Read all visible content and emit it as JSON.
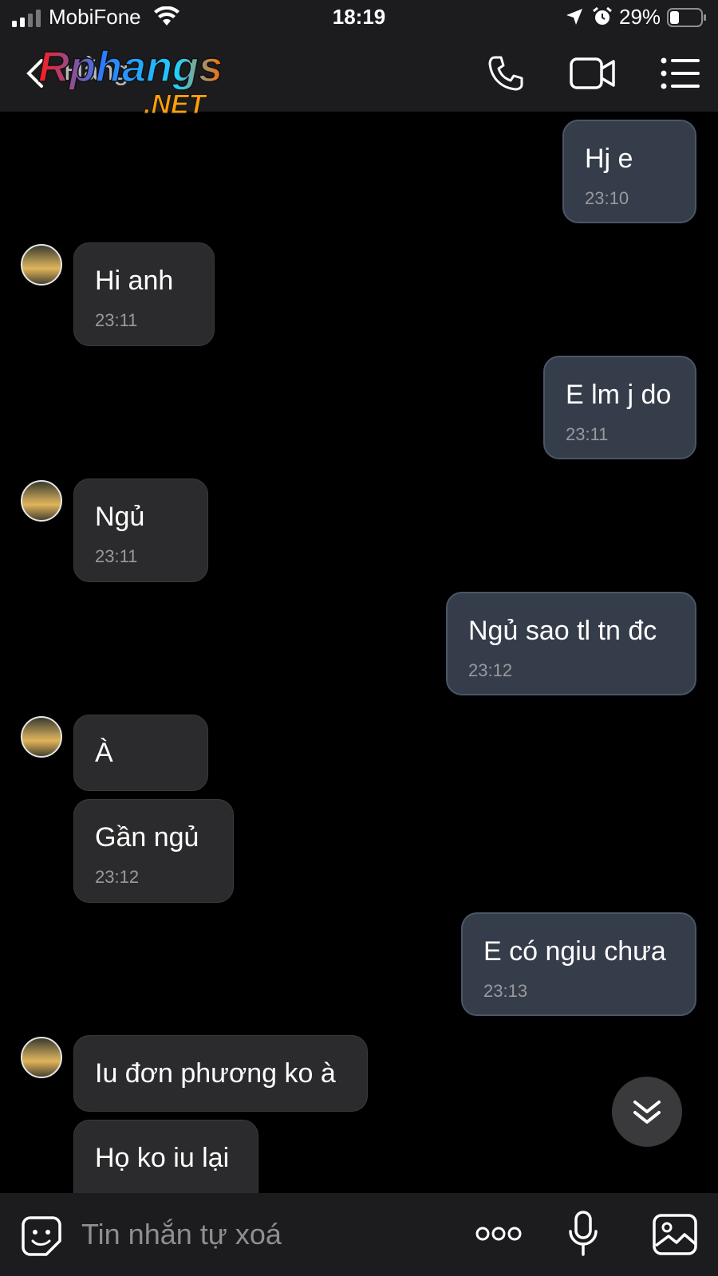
{
  "status_bar": {
    "carrier": "MobiFone",
    "time": "18:19",
    "battery": "29%"
  },
  "header": {
    "contact_name": "Hằng",
    "watermark_text": "Rphangs",
    "watermark_subtext": ".NET"
  },
  "messages": [
    {
      "direction": "out",
      "text": "Hj e",
      "time": "23:10"
    },
    {
      "direction": "in",
      "text": " Hi anh",
      "time": "23:11"
    },
    {
      "direction": "out",
      "text": "E lm j do",
      "time": "23:11"
    },
    {
      "direction": "in",
      "text": "Ngủ",
      "time": "23:11"
    },
    {
      "direction": "out",
      "text": "Ngủ sao tl tn đc",
      "time": "23:12"
    },
    {
      "direction": "in",
      "text": "À",
      "time": ""
    },
    {
      "direction": "in",
      "text": "Gần ngủ",
      "time": "23:12"
    },
    {
      "direction": "out",
      "text": "E có ngiu chưa",
      "time": "23:13"
    },
    {
      "direction": "in",
      "text": "Iu đơn phương ko à",
      "time": ""
    },
    {
      "direction": "in",
      "text": "Họ ko iu lại",
      "time": ""
    }
  ],
  "composer": {
    "placeholder": "Tin nhắn tự xoá"
  },
  "colors": {
    "background": "#000000",
    "outgoing_bubble": "#353d4a",
    "incoming_bubble": "#2b2b2d",
    "bar": "#1c1c1e"
  }
}
